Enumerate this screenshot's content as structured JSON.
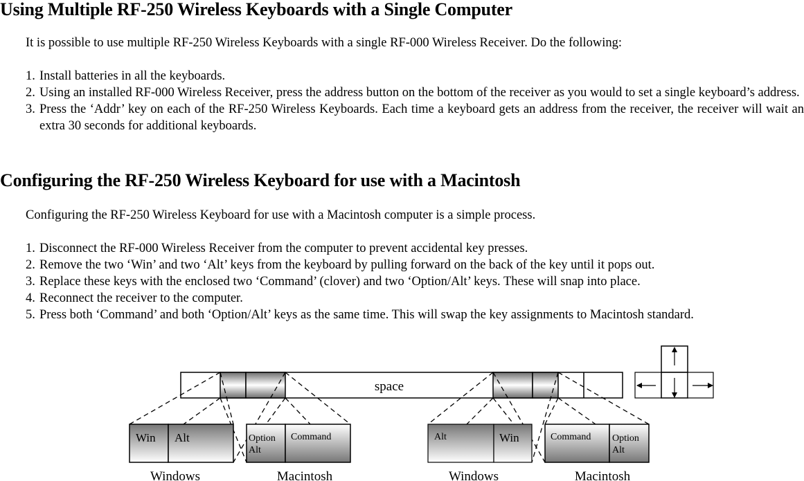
{
  "section1": {
    "heading": "Using Multiple RF-250 Wireless Keyboards with a Single Computer",
    "intro": "It is possible to use multiple RF-250 Wireless Keyboards with a single RF-000 Wireless Receiver. Do the following:",
    "steps": [
      {
        "num": "1.",
        "text": "Install batteries in all the keyboards."
      },
      {
        "num": "2.",
        "text": "Using an installed RF-000 Wireless Receiver, press the address button on the bottom of the receiver as you would to set a single keyboard’s address."
      },
      {
        "num": "3.",
        "text": "Press the ‘Addr’ key on each of the RF-250 Wireless Keyboards. Each time a keyboard gets an address from the receiver, the receiver will wait an extra 30 seconds for additional keyboards."
      }
    ]
  },
  "section2": {
    "heading": "Configuring the RF-250 Wireless Keyboard for use with a Macintosh",
    "intro": "Configuring the RF-250 Wireless Keyboard for use with a Macintosh computer is a simple process.",
    "steps": [
      {
        "num": "1.",
        "text": "Disconnect the RF-000 Wireless Receiver from the computer to prevent accidental key presses."
      },
      {
        "num": "2.",
        "text": "Remove the two ‘Win’ and two ‘Alt’ keys from the keyboard by pulling forward on the back of the key until it pops out."
      },
      {
        "num": "3.",
        "text": "Replace these keys with the enclosed two ‘Command’ (clover) and two ‘Option/Alt’ keys. These will snap into place."
      },
      {
        "num": "4.",
        "text": "Reconnect the receiver to the computer."
      },
      {
        "num": "5.",
        "text": "Press both ‘Command’ and both ‘Option/Alt’ keys as the same time. This will swap the key assignments to Macintosh standard."
      }
    ]
  },
  "diagram": {
    "space_label": "space",
    "left_windows": {
      "keys": [
        "Win",
        "Alt"
      ],
      "caption": "Windows"
    },
    "left_mac": {
      "keys": [
        "Option",
        "Alt",
        "Command"
      ],
      "caption": "Macintosh"
    },
    "right_windows": {
      "keys": [
        "Alt",
        "Win"
      ],
      "caption": "Windows"
    },
    "right_mac": {
      "keys": [
        "Command",
        "Option",
        "Alt"
      ],
      "caption": "Macintosh"
    },
    "arrow_keys": [
      "up-arrow",
      "left-arrow",
      "down-arrow",
      "right-arrow"
    ]
  }
}
